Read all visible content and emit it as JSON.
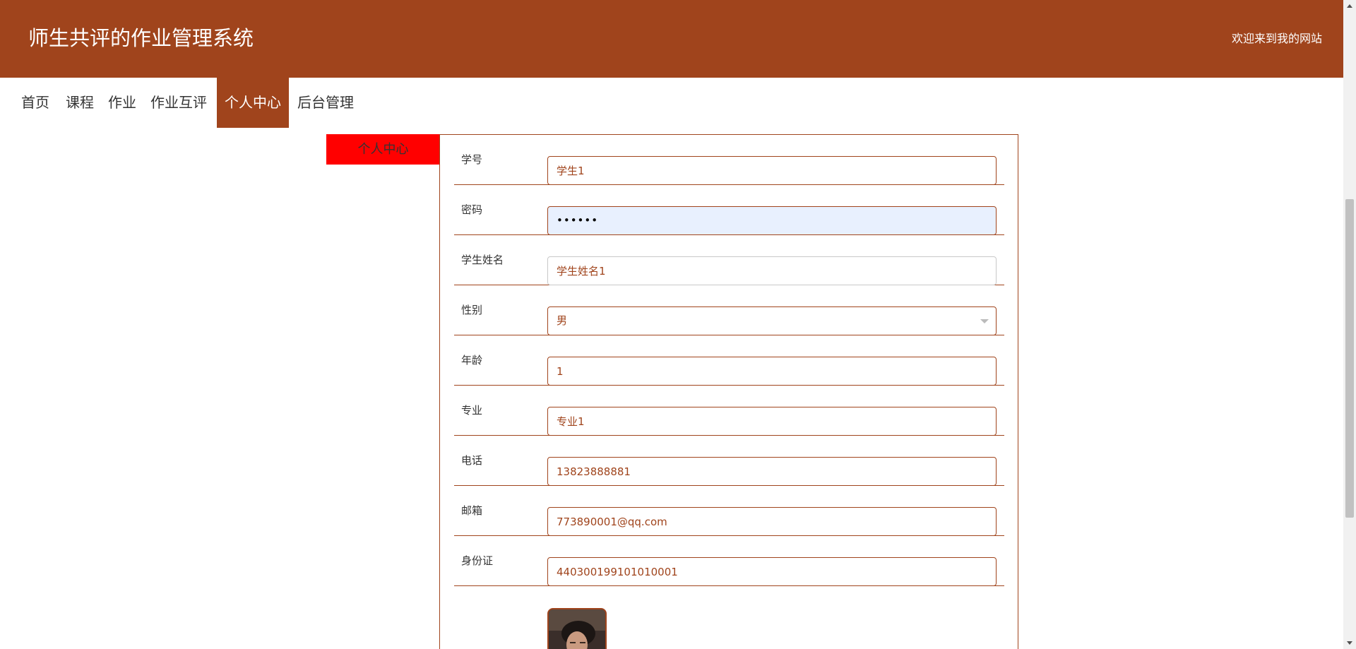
{
  "header": {
    "site_title": "师生共评的作业管理系统",
    "welcome": "欢迎来到我的网站"
  },
  "nav": {
    "items": [
      {
        "label": "首页"
      },
      {
        "label": "课程"
      },
      {
        "label": "作业"
      },
      {
        "label": "作业互评"
      },
      {
        "label": "个人中心",
        "active": true
      },
      {
        "label": "后台管理"
      }
    ]
  },
  "sidebar": {
    "title": "个人中心"
  },
  "form": {
    "student_id": {
      "label": "学号",
      "value": "学生1"
    },
    "password": {
      "label": "密码",
      "value": "••••••"
    },
    "student_name": {
      "label": "学生姓名",
      "value": "学生姓名1"
    },
    "gender": {
      "label": "性别",
      "value": "男"
    },
    "age": {
      "label": "年龄",
      "value": "1"
    },
    "major": {
      "label": "专业",
      "value": "专业1"
    },
    "phone": {
      "label": "电话",
      "value": "13823888881"
    },
    "email": {
      "label": "邮箱",
      "value": "773890001@qq.com"
    },
    "id_card": {
      "label": "身份证",
      "value": "440300199101010001"
    }
  },
  "colors": {
    "brand": "#a0441c",
    "sidebar_highlight": "#ff0000",
    "autofill_background": "#e8f0fe"
  }
}
